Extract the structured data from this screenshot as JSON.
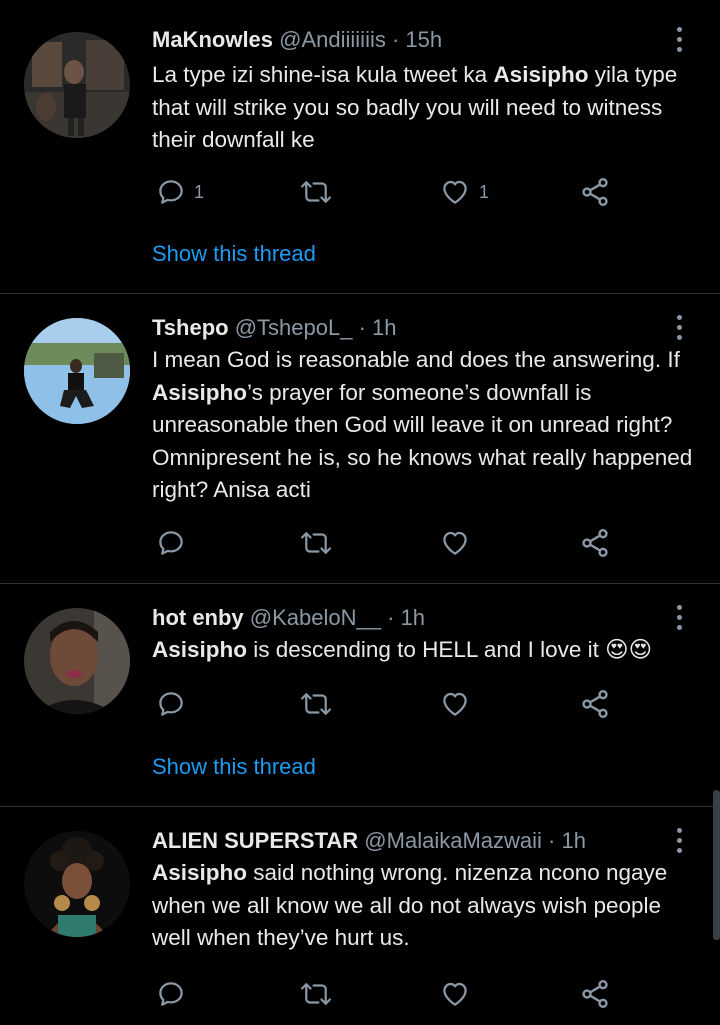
{
  "tweets": [
    {
      "name": "MaKnowles",
      "handle": "@Andiiiiiiis",
      "sep": " · ",
      "time": "15h",
      "parts": [
        {
          "text": "La type izi shine-isa kula tweet ka ",
          "bold": false
        },
        {
          "text": "Asisipho",
          "bold": true
        },
        {
          "text": " yila type that will strike you so badly you will need to witness their downfall ke",
          "bold": false
        }
      ],
      "reply_count": "1",
      "retweet_count": "",
      "like_count": "1",
      "show_thread": "Show this thread"
    },
    {
      "name": "Tshepo",
      "handle": "@TshepoL_",
      "sep": " · ",
      "time": "1h",
      "parts": [
        {
          "text": "I mean God is reasonable and does the answering. If ",
          "bold": false
        },
        {
          "text": "Asisipho",
          "bold": true
        },
        {
          "text": "’s prayer for someone’s downfall is unreasonable then God will leave it on unread right? Omnipresent he is, so he knows what really happened right? Anisa acti",
          "bold": false
        }
      ],
      "reply_count": "",
      "retweet_count": "",
      "like_count": "",
      "show_thread": ""
    },
    {
      "name": "hot enby",
      "handle": "@KabeloN__",
      "sep": " · ",
      "time": "1h",
      "parts": [
        {
          "text": "Asisipho",
          "bold": true
        },
        {
          "text": " is descending to HELL and I love it ",
          "bold": false
        }
      ],
      "emoji": "😍😍",
      "reply_count": "",
      "retweet_count": "",
      "like_count": "",
      "show_thread": "Show this thread"
    },
    {
      "name": "ALIEN SUPERSTAR",
      "handle": "@MalaikaMazwaii",
      "sep": " · ",
      "time": "1h",
      "parts": [
        {
          "text": "Asisipho",
          "bold": true
        },
        {
          "text": " said nothing wrong. nizenza ncono ngaye when we all know we all do not always wish people well when they’ve hurt us.",
          "bold": false
        }
      ],
      "reply_count": "",
      "retweet_count": "",
      "like_count": "",
      "show_thread": ""
    }
  ],
  "colors": {
    "background": "#000000",
    "text": "#e7e9ea",
    "secondary": "#8b98a5",
    "link": "#1d9bf0",
    "divider": "#2f3336"
  },
  "icons": [
    "reply-icon",
    "retweet-icon",
    "like-icon",
    "share-icon",
    "more-icon"
  ]
}
